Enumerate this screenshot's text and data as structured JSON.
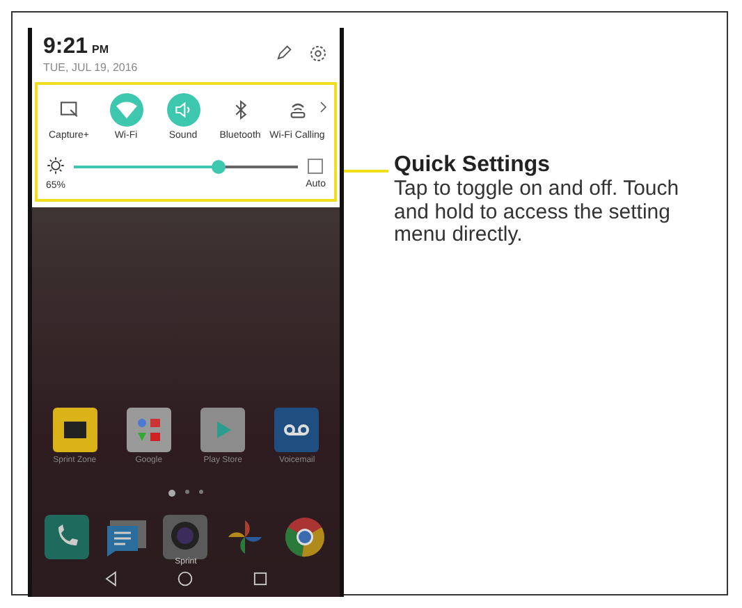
{
  "status": {
    "time": "9:21",
    "ampm": "PM",
    "date": "TUE, JUL 19, 2016"
  },
  "quick_settings": {
    "toggles": [
      {
        "kind": "capture",
        "label": "Capture+",
        "on": false
      },
      {
        "kind": "wifi",
        "label": "Wi-Fi",
        "on": true
      },
      {
        "kind": "sound",
        "label": "Sound",
        "on": true
      },
      {
        "kind": "bluetooth",
        "label": "Bluetooth",
        "on": false
      },
      {
        "kind": "wifi-calling",
        "label": "Wi-Fi Calling",
        "on": false
      }
    ],
    "brightness": {
      "reading": "65%",
      "level": 0.65,
      "auto_label": "Auto",
      "auto_checked": false
    }
  },
  "home_apps": [
    {
      "kind": "sprint-zone",
      "label": "Sprint Zone"
    },
    {
      "kind": "google",
      "label": "Google"
    },
    {
      "kind": "play-store",
      "label": "Play Store"
    },
    {
      "kind": "voicemail",
      "label": "Voicemail"
    }
  ],
  "page_dots": [
    {
      "selected": true
    },
    {
      "selected": false
    },
    {
      "selected": false
    }
  ],
  "dock": [
    {
      "kind": "phone"
    },
    {
      "kind": "messages"
    },
    {
      "kind": "camera",
      "label": "Sprint"
    },
    {
      "kind": "photos"
    },
    {
      "kind": "browser"
    }
  ],
  "callout": {
    "title": "Quick Settings",
    "text": "Tap to toggle on and off. Touch and hold to access the setting menu directly."
  }
}
